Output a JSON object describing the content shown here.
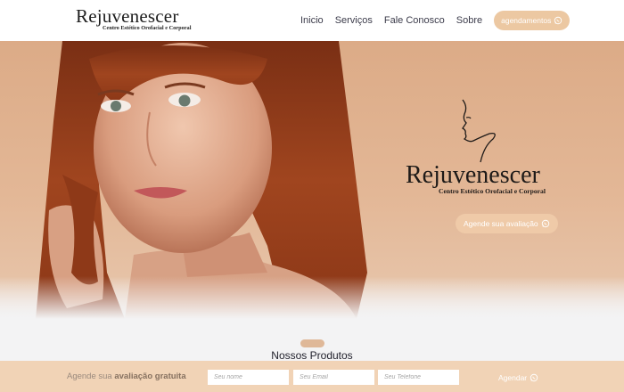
{
  "header": {
    "logo_title": "Rejuvenescer",
    "logo_subtitle": "Centro Estético Orofacial e Corporal",
    "nav": [
      "Inicio",
      "Serviços",
      "Fale Conosco",
      "Sobre"
    ],
    "cta_label": "agendamentos"
  },
  "hero": {
    "logo_title": "Rejuvenescer",
    "logo_subtitle": "Centro Estético Orofacial e Corporal",
    "cta_label": "Agende sua avaliação"
  },
  "products": {
    "title": "Nossos Produtos"
  },
  "booking_bar": {
    "text_prefix": "Agende sua",
    "text_bold": "avaliação gratuita",
    "name_placeholder": "Seu nome",
    "email_placeholder": "Seu Email",
    "phone_placeholder": "Seu Telefone",
    "submit_label": "Agendar"
  },
  "colors": {
    "accent": "#ecc8a2",
    "hero_bg": "#e0b08c",
    "bar_bg": "#f1d3b6"
  },
  "icons": [
    "whatsapp-icon",
    "face-line-art-icon"
  ]
}
